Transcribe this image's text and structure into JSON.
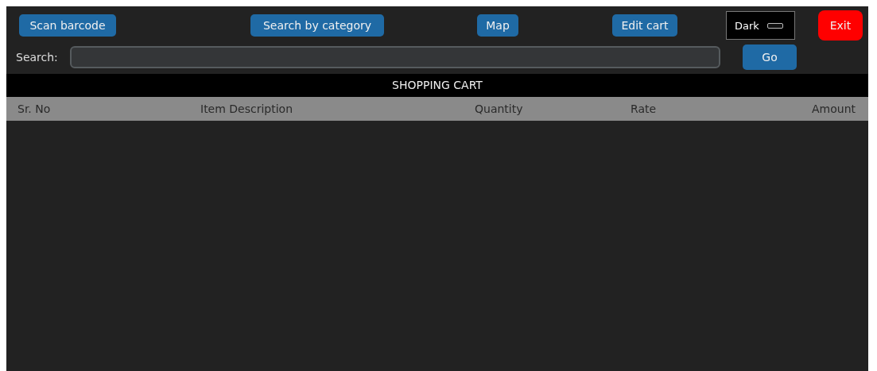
{
  "toolbar": {
    "buttons": [
      {
        "label": "Scan barcode",
        "kind": "normal"
      },
      {
        "label": "Search by category",
        "kind": "normal"
      },
      {
        "label": "Map",
        "kind": "normal"
      },
      {
        "label": "Edit cart",
        "kind": "normal"
      }
    ],
    "theme_switch": {
      "label": "Dark",
      "on": false
    },
    "exit_button": {
      "label": "Exit",
      "kind": "danger"
    }
  },
  "search": {
    "label": "Search:",
    "go_button": "Go"
  },
  "cart": {
    "title": "SHOPPING CART",
    "columns": [
      "Sr. No",
      "Item Description",
      "Quantity",
      "Rate",
      "Amount"
    ]
  }
}
